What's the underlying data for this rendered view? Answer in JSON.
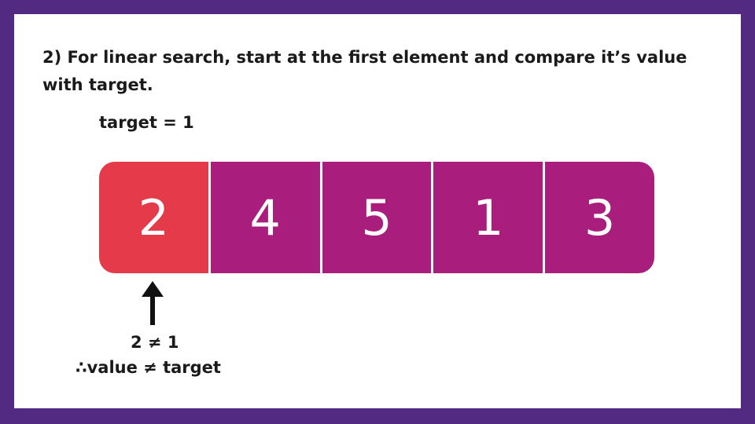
{
  "instruction": "2) For linear search, start at the first element and compare it’s value with target.",
  "target_label": "target = 1",
  "array": {
    "values": [
      "2",
      "4",
      "5",
      "1",
      "3"
    ],
    "current_index": 0
  },
  "pointer_icon": "up-arrow-icon",
  "comparison": "2 ≠ 1",
  "conclusion": "∴value ≠ target",
  "colors": {
    "frame": "#532a82",
    "cell": "#a91e7c",
    "current_cell": "#e43a4a",
    "text": "#1a1a1a"
  }
}
